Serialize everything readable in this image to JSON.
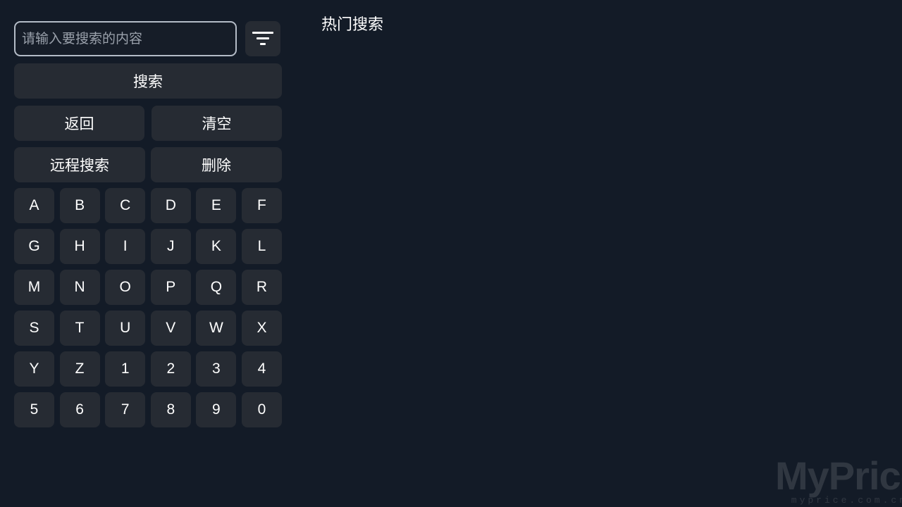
{
  "search": {
    "placeholder": "请输入要搜索的内容",
    "value": "",
    "filter_icon": "filter-icon"
  },
  "actions": {
    "search_label": "搜索",
    "back_label": "返回",
    "clear_label": "清空",
    "remote_search_label": "远程搜索",
    "delete_label": "删除"
  },
  "keyboard": {
    "keys": [
      "A",
      "B",
      "C",
      "D",
      "E",
      "F",
      "G",
      "H",
      "I",
      "J",
      "K",
      "L",
      "M",
      "N",
      "O",
      "P",
      "Q",
      "R",
      "S",
      "T",
      "U",
      "V",
      "W",
      "X",
      "Y",
      "Z",
      "1",
      "2",
      "3",
      "4",
      "5",
      "6",
      "7",
      "8",
      "9",
      "0"
    ]
  },
  "hot_search": {
    "title": "热门搜索"
  },
  "watermark": {
    "main": "MyPrice",
    "sub": "myprice.com.cn"
  },
  "colors": {
    "background": "#131b27",
    "button": "#262b33",
    "input_border": "#b4bcc7",
    "text": "#ffffff",
    "placeholder": "#9aa1ab"
  }
}
